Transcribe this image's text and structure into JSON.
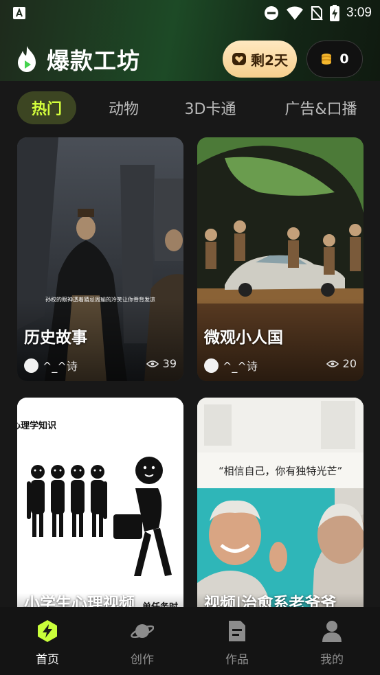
{
  "status_bar": {
    "time": "3:09"
  },
  "header": {
    "app_title": "爆款工坊",
    "vip_label": "剩2天",
    "coin_count": "0"
  },
  "tabs": [
    {
      "label": "热门",
      "active": true
    },
    {
      "label": "动物",
      "active": false
    },
    {
      "label": "3D卡通",
      "active": false
    },
    {
      "label": "广告&口播",
      "active": false
    }
  ],
  "cards": [
    {
      "title": "历史故事",
      "author": "^_^诗",
      "views": "39",
      "caption": "孙权的眼神透着猜忌周瑜的冷笑让你脊背发凉"
    },
    {
      "title": "微观小人国",
      "author": "^_^诗",
      "views": "20"
    },
    {
      "title": "小学生心理视频",
      "overlay_text": "心理学知识",
      "side_text": "单任务时"
    },
    {
      "title": "视频|治愈系老爷爷",
      "overlay_text": "“相信自己，你有独特光芒”"
    }
  ],
  "bottom_nav": [
    {
      "label": "首页",
      "icon": "lightning-icon",
      "active": true
    },
    {
      "label": "创作",
      "icon": "planet-icon",
      "active": false
    },
    {
      "label": "作品",
      "icon": "document-icon",
      "active": false
    },
    {
      "label": "我的",
      "icon": "user-icon",
      "active": false
    }
  ],
  "colors": {
    "accent": "#d4ff3c",
    "tab_active_bg": "#3c4522",
    "vip_gold": "#f6cf8e",
    "background": "#181818"
  }
}
